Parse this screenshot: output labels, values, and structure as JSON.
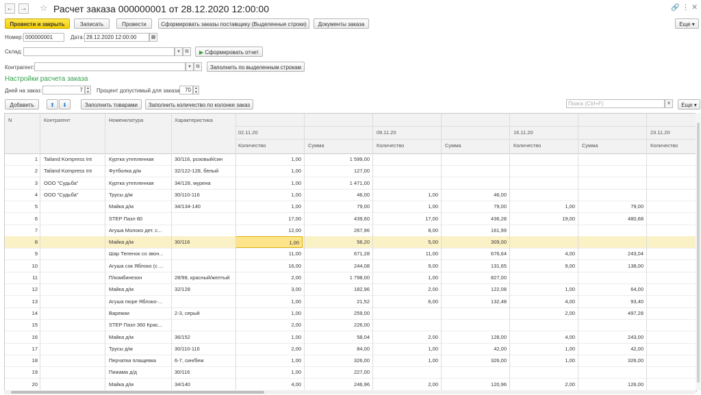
{
  "window": {
    "title": "Расчет заказа 000000001 от 28.12.2020 12:00:00",
    "more_label": "Еще"
  },
  "toolbar": {
    "post_close": "Провести и закрыть",
    "save": "Записать",
    "post": "Провести",
    "form_orders": "Сформировать заказы поставщику (Выделенные строки)",
    "order_docs": "Документы заказа",
    "more": "Еще"
  },
  "header": {
    "number_label": "Номер:",
    "number_value": "000000001",
    "date_label": "Дата:",
    "date_value": "28.12.2020 12:00:00",
    "warehouse_label": "Склад:",
    "warehouse_value": "",
    "report_button": "Сформировать отчет",
    "counterparty_label": "Контрагент:",
    "counterparty_value": "",
    "fill_selected_button": "Заполнить по выделенным строкам"
  },
  "settings": {
    "title": "Настройки расчета заказа",
    "days_label": "Дней на заказ:",
    "days_value": "7",
    "percent_label": "Процент допустимый для заказа:",
    "percent_value": "70"
  },
  "table_toolbar": {
    "add": "Добавить",
    "fill_goods": "Заполнить товарами",
    "fill_qty": "Заполнить количество по колонке заказ",
    "search_placeholder": "Поиск (Ctrl+F)",
    "more": "Еще"
  },
  "table": {
    "columns": {
      "n": "N",
      "counterparty": "Контрагент",
      "item": "Номенклатура",
      "characteristic": "Характеристика"
    },
    "periods": [
      "02.11.20",
      "09.11.20",
      "16.11.20",
      "23.11.20"
    ],
    "sub_qty": "Количество",
    "sub_sum": "Сумма",
    "rows": [
      {
        "n": "1",
        "cp": "Tailand Kompress Int",
        "item": "Куртка утепленная",
        "ch": "30/116, розовый/син",
        "q1": "1,00",
        "s1": "1 599,00",
        "q2": "",
        "s2": "",
        "q3": "",
        "s3": "",
        "q4": ""
      },
      {
        "n": "2",
        "cp": "Tailand Kompress Int",
        "item": "Футболка д/м",
        "ch": "32/122-128, белый",
        "q1": "1,00",
        "s1": "127,00",
        "q2": "",
        "s2": "",
        "q3": "",
        "s3": "",
        "q4": ""
      },
      {
        "n": "3",
        "cp": "ООО \"Судьба\"",
        "item": "Куртка утепленная",
        "ch": "34/128, мурена",
        "q1": "1,00",
        "s1": "1 471,00",
        "q2": "",
        "s2": "",
        "q3": "",
        "s3": "",
        "q4": ""
      },
      {
        "n": "4",
        "cp": "ООО \"Судьба\"",
        "item": "Трусы д/м",
        "ch": "30/110-116",
        "q1": "1,00",
        "s1": "46,00",
        "q2": "1,00",
        "s2": "46,00",
        "q3": "",
        "s3": "",
        "q4": ""
      },
      {
        "n": "5",
        "cp": "",
        "item": "Майка д/м",
        "ch": "34/134-140",
        "q1": "1,00",
        "s1": "79,00",
        "q2": "1,00",
        "s2": "79,00",
        "q3": "1,00",
        "s3": "79,00",
        "q4": ""
      },
      {
        "n": "6",
        "cp": "",
        "item": "STEP Пазл 80",
        "ch": "",
        "q1": "17,00",
        "s1": "439,60",
        "q2": "17,00",
        "s2": "436,28",
        "q3": "19,00",
        "s3": "480,68",
        "q4": ""
      },
      {
        "n": "7",
        "cp": "",
        "item": "Агуша Молоко дет. с...",
        "ch": "",
        "q1": "12,00",
        "s1": "267,96",
        "q2": "8,00",
        "s2": "161,99",
        "q3": "",
        "s3": "",
        "q4": ""
      },
      {
        "n": "8",
        "cp": "",
        "item": "Майка д/м",
        "ch": "30/116",
        "q1": "1,00",
        "s1": "56,20",
        "q2": "5,00",
        "s2": "309,00",
        "q3": "",
        "s3": "",
        "q4": "",
        "selected": true
      },
      {
        "n": "9",
        "cp": "",
        "item": "Шар Теленок со звон...",
        "ch": "",
        "q1": "11,00",
        "s1": "671,28",
        "q2": "11,00",
        "s2": "676,64",
        "q3": "4,00",
        "s3": "243,04",
        "q4": ""
      },
      {
        "n": "10",
        "cp": "",
        "item": "Агуша сок Яблоко (с ...",
        "ch": "",
        "q1": "16,00",
        "s1": "244,08",
        "q2": "9,00",
        "s2": "131,65",
        "q3": "9,00",
        "s3": "138,00",
        "q4": ""
      },
      {
        "n": "11",
        "cp": "",
        "item": "П/комбинезон",
        "ch": "28/98, красный/желтый",
        "q1": "2,00",
        "s1": "1 798,00",
        "q2": "1,00",
        "s2": "827,00",
        "q3": "",
        "s3": "",
        "q4": ""
      },
      {
        "n": "12",
        "cp": "",
        "item": "Майка д/м",
        "ch": "32/128",
        "q1": "3,00",
        "s1": "182,96",
        "q2": "2,00",
        "s2": "122,08",
        "q3": "1,00",
        "s3": "64,00",
        "q4": ""
      },
      {
        "n": "13",
        "cp": "",
        "item": "Агуша пюре Яблоко-...",
        "ch": "",
        "q1": "1,00",
        "s1": "21,52",
        "q2": "6,00",
        "s2": "132,48",
        "q3": "4,00",
        "s3": "93,40",
        "q4": ""
      },
      {
        "n": "14",
        "cp": "",
        "item": "Варежки",
        "ch": "2-3, серый",
        "q1": "1,00",
        "s1": "259,00",
        "q2": "",
        "s2": "",
        "q3": "2,00",
        "s3": "497,28",
        "q4": ""
      },
      {
        "n": "15",
        "cp": "",
        "item": "STEP Пазл 360 Крас...",
        "ch": "",
        "q1": "2,00",
        "s1": "226,00",
        "q2": "",
        "s2": "",
        "q3": "",
        "s3": "",
        "q4": ""
      },
      {
        "n": "16",
        "cp": "",
        "item": "Майка д/м",
        "ch": "36/152",
        "q1": "1,00",
        "s1": "58,04",
        "q2": "2,00",
        "s2": "128,00",
        "q3": "4,00",
        "s3": "243,00",
        "q4": ""
      },
      {
        "n": "17",
        "cp": "",
        "item": "Трусы д/м",
        "ch": "30/110-116",
        "q1": "2,00",
        "s1": "84,00",
        "q2": "1,00",
        "s2": "42,00",
        "q3": "1,00",
        "s3": "42,00",
        "q4": ""
      },
      {
        "n": "18",
        "cp": "",
        "item": "Перчатки плащевка",
        "ch": "6-7, син/беж",
        "q1": "1,00",
        "s1": "326,00",
        "q2": "1,00",
        "s2": "326,00",
        "q3": "1,00",
        "s3": "326,00",
        "q4": ""
      },
      {
        "n": "19",
        "cp": "",
        "item": "Пижама д/д",
        "ch": "30/116",
        "q1": "1,00",
        "s1": "227,00",
        "q2": "",
        "s2": "",
        "q3": "",
        "s3": "",
        "q4": ""
      },
      {
        "n": "20",
        "cp": "",
        "item": "Майка д/м",
        "ch": "34/140",
        "q1": "4,00",
        "s1": "246,96",
        "q2": "2,00",
        "s2": "120,96",
        "q3": "2,00",
        "s3": "126,00",
        "q4": ""
      }
    ]
  }
}
